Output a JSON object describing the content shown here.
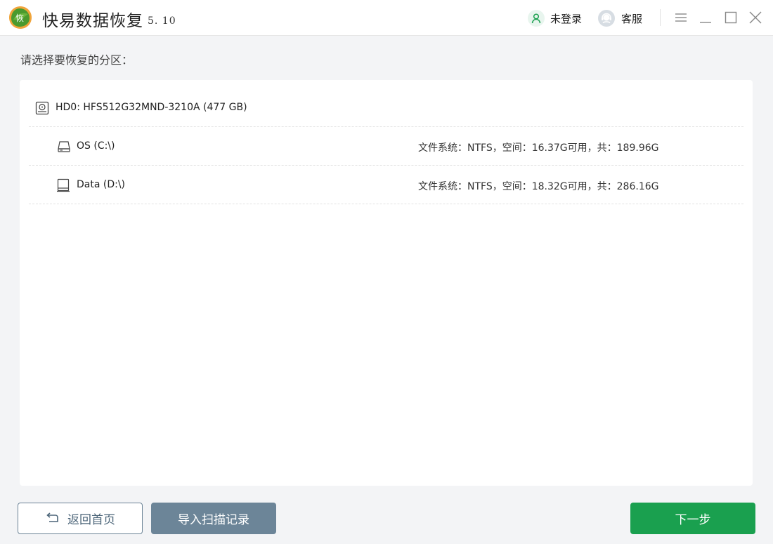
{
  "app": {
    "title": "快易数据恢复",
    "version": "5. 10",
    "logo_text": "恢"
  },
  "header": {
    "login_label": "未登录",
    "service_label": "客服"
  },
  "main": {
    "prompt": "请选择要恢复的分区："
  },
  "disks": [
    {
      "name": "HD0: HFS512G32MND-3210A (477 GB)",
      "info": ""
    },
    {
      "name": "OS (C:\\)",
      "info": "文件系统：NTFS，空间：16.37G可用，共：189.96G"
    },
    {
      "name": "Data (D:\\)",
      "info": "文件系统：NTFS，空间：18.32G可用，共：286.16G"
    }
  ],
  "footer": {
    "back_label": "返回首页",
    "import_label": "导入扫描记录",
    "next_label": "下一步"
  },
  "colors": {
    "accent_green": "#1aa04f",
    "slate": "#6c8598"
  }
}
